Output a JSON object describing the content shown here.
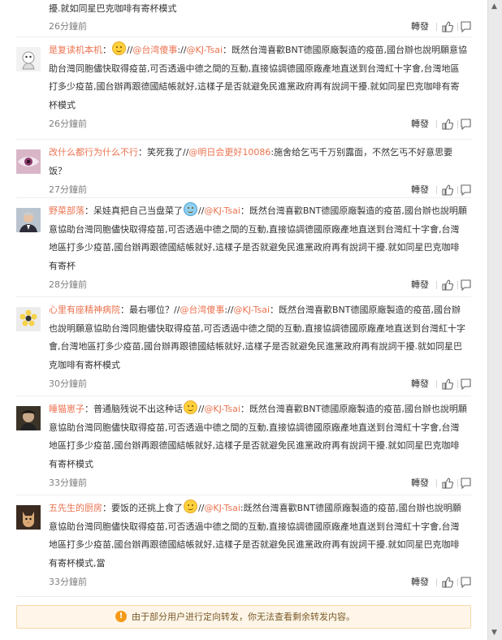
{
  "top_fragment": {
    "text": "擾.就如同星巴克咖啡有寄杯模式",
    "time": "26分鐘前"
  },
  "actions": {
    "forward_label": "轉發"
  },
  "comments": [
    {
      "user": "是复读机本机",
      "segments": [
        {
          "kind": "text",
          "text": "："
        },
        {
          "kind": "emoji"
        },
        {
          "kind": "text",
          "text": "//"
        },
        {
          "kind": "at",
          "text": "@台湾傻事"
        },
        {
          "kind": "text",
          "text": "://"
        },
        {
          "kind": "at",
          "text": "@KJ-Tsai"
        },
        {
          "kind": "text",
          "text": "：既然台灣喜歡BNT德國原廠製造的疫苗,國台辦也說明願意協助台灣同胞儘快取得疫苗,可否透過中德之間的互動,直接協調德國原廠產地直送到台灣紅十字會,台灣地區打多少疫苗,國台辦再跟德國結帳就好,這樣子是否就避免民進黨政府再有說詞干擾.就如同星巴克咖啡有寄杯模式"
        }
      ],
      "time": "26分鐘前"
    },
    {
      "user": "改什么都行为什么不行",
      "segments": [
        {
          "kind": "text",
          "text": "：笑死我了//"
        },
        {
          "kind": "at",
          "text": "@明日会更好10086"
        },
        {
          "kind": "text",
          "text": ":施舍给乞丐千万别露面，不然乞丐不好意思要饭？"
        }
      ],
      "time": "27分鐘前"
    },
    {
      "user": "野菜部落",
      "segments": [
        {
          "kind": "text",
          "text": "：呆娃真把自己当盘菜了"
        },
        {
          "kind": "emoji-blue"
        },
        {
          "kind": "text",
          "text": "//"
        },
        {
          "kind": "at",
          "text": "@KJ-Tsai"
        },
        {
          "kind": "text",
          "text": "：既然台灣喜歡BNT德國原廠製造的疫苗,國台辦也說明願意協助台灣同胞儘快取得疫苗,可否透過中德之間的互動,直接協調德國原廠產地直送到台灣紅十字會,台灣地區打多少疫苗,國台辦再跟德國結帳就好,這樣子是否就避免民進黨政府再有說詞干擾.就如同星巴克咖啡有寄杯"
        }
      ],
      "time": "28分鐘前"
    },
    {
      "user": "心里有座精神病院",
      "segments": [
        {
          "kind": "text",
          "text": "：最右哪位？//"
        },
        {
          "kind": "at",
          "text": "@台湾傻事"
        },
        {
          "kind": "text",
          "text": "://"
        },
        {
          "kind": "at",
          "text": "@KJ-Tsai"
        },
        {
          "kind": "text",
          "text": "：既然台灣喜歡BNT德國原廠製造的疫苗,國台辦也說明願意協助台灣同胞儘快取得疫苗,可否透過中德之間的互動,直接協調德國原廠產地直送到台灣紅十字會,台灣地區打多少疫苗,國台辦再跟德國結帳就好,這樣子是否就避免民進黨政府再有說詞干擾.就如同星巴克咖啡有寄杯模式"
        }
      ],
      "time": "30分鐘前"
    },
    {
      "user": "睡猫崽子",
      "segments": [
        {
          "kind": "text",
          "text": "：普通脑残说不出这种话"
        },
        {
          "kind": "emoji"
        },
        {
          "kind": "text",
          "text": "//"
        },
        {
          "kind": "at",
          "text": "@KJ-Tsai"
        },
        {
          "kind": "text",
          "text": "：既然台灣喜歡BNT德國原廠製造的疫苗,國台辦也說明願意協助台灣同胞儘快取得疫苗,可否透過中德之間的互動,直接協調德國原廠產地直送到台灣紅十字會,台灣地區打多少疫苗,國台辦再跟德國結帳就好,這樣子是否就避免民進黨政府再有說詞干擾.就如同星巴克咖啡有寄杯模式"
        }
      ],
      "time": "33分鐘前"
    },
    {
      "user": "五先生的厨房",
      "segments": [
        {
          "kind": "text",
          "text": "：要饭的还挑上食了"
        },
        {
          "kind": "emoji"
        },
        {
          "kind": "text",
          "text": "//"
        },
        {
          "kind": "at",
          "text": "@KJ-Tsai"
        },
        {
          "kind": "text",
          "text": ":既然台灣喜歡BNT德國原廠製造的疫苗,國台辦也說明願意協助台灣同胞儘快取得疫苗,可否透過中德之間的互動,直接協調德國原廠產地直送到台灣紅十字會,台灣地區打多少疫苗,國台辦再跟德國結帳就好,這樣子是否就避免民進黨政府再有說詞干擾.就如同星巴克咖啡有寄杯模式,當"
        }
      ],
      "time": "33分鐘前"
    }
  ],
  "notice": {
    "icon": "warning-icon",
    "text": "由于部分用户进行定向转发，你无法查看剩余转发内容。"
  },
  "colors": {
    "link": "#eb7350",
    "text": "#333333",
    "meta": "#808080",
    "notice_bg": "#fff6e9"
  }
}
